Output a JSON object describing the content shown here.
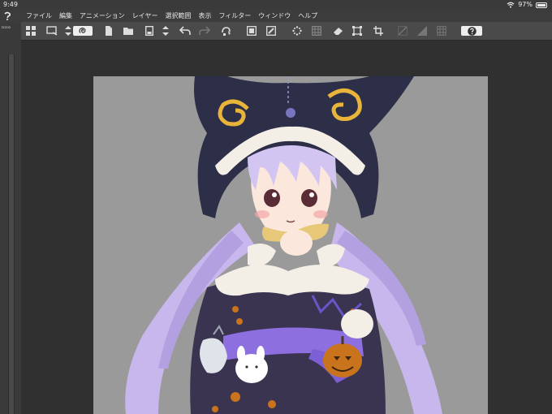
{
  "status": {
    "time": "9:49",
    "battery": "97%",
    "battery_level": 0.97
  },
  "menu": {
    "items": [
      "ファイル",
      "編集",
      "アニメーション",
      "レイヤー",
      "選択範囲",
      "表示",
      "フィルター",
      "ウィンドウ",
      "ヘルプ"
    ]
  },
  "toolbar": {
    "icons": [
      "layout-grid-icon",
      "window-mode-icon",
      "scroll-arrows-icon",
      "spiral-icon",
      "new-file-icon",
      "open-folder-icon",
      "save-icon",
      "save-arrows-icon",
      "undo-icon",
      "redo-icon",
      "fill-bucket-icon",
      "layer-panel-icon",
      "brush-panel-icon",
      "dotted-select-icon",
      "transform-grid-icon",
      "eraser-icon",
      "select-box-icon",
      "crop-icon",
      "disabled-slash-icon",
      "disabled-fill-icon",
      "disabled-grid-icon",
      "help-icon"
    ]
  },
  "colors": {
    "background": "#2b2b2b",
    "menubar": "#3c3c3c",
    "toolbar": "#4a4a4a",
    "canvas_bg": "#9a9a9a",
    "hood": "#2d2e48",
    "hair": "#c7b7ec",
    "ribbon": "#8d6fe0",
    "bow": "#e7c778",
    "pumpkin": "#c9741c"
  }
}
